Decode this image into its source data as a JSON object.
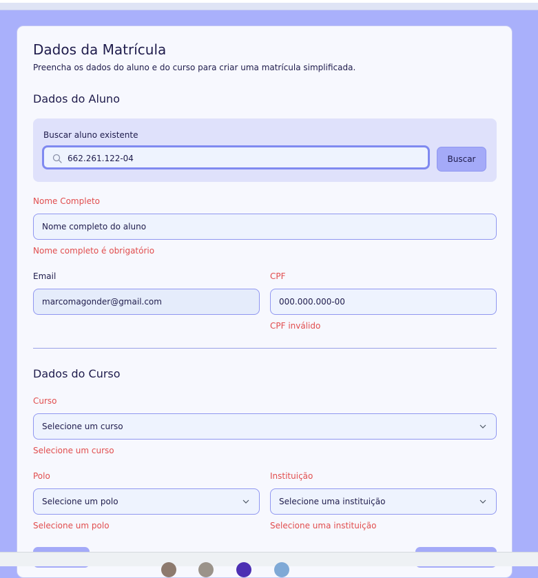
{
  "form": {
    "title": "Dados da Matrícula",
    "subtitle": "Preencha os dados do aluno e do curso para criar uma matrícula simplificada."
  },
  "student": {
    "heading": "Dados do Aluno",
    "search": {
      "label": "Buscar aluno existente",
      "value": "662.261.122-04",
      "icon": "search-icon",
      "button_label": "Buscar"
    },
    "name": {
      "label": "Nome Completo",
      "placeholder": "Nome completo do aluno",
      "error": "Nome completo é obrigatório"
    },
    "email": {
      "label": "Email",
      "value": "marcomagonder@gmail.com"
    },
    "cpf": {
      "label": "CPF",
      "placeholder": "000.000.000-00",
      "error": "CPF inválido"
    }
  },
  "course": {
    "heading": "Dados do Curso",
    "curso": {
      "label": "Curso",
      "selected": "Selecione um curso",
      "error": "Selecione um curso"
    },
    "polo": {
      "label": "Polo",
      "selected": "Selecione um polo",
      "error": "Selecione um polo"
    },
    "instituicao": {
      "label": "Instituição",
      "selected": "Selecione uma instituição",
      "error": "Selecione uma instituição"
    }
  },
  "colors": {
    "page_background": "#a9b0fb",
    "error": "#e14d4d",
    "button": "#a4aaf8",
    "input_border": "#8f96f0",
    "focus_border": "#7f89f0"
  }
}
